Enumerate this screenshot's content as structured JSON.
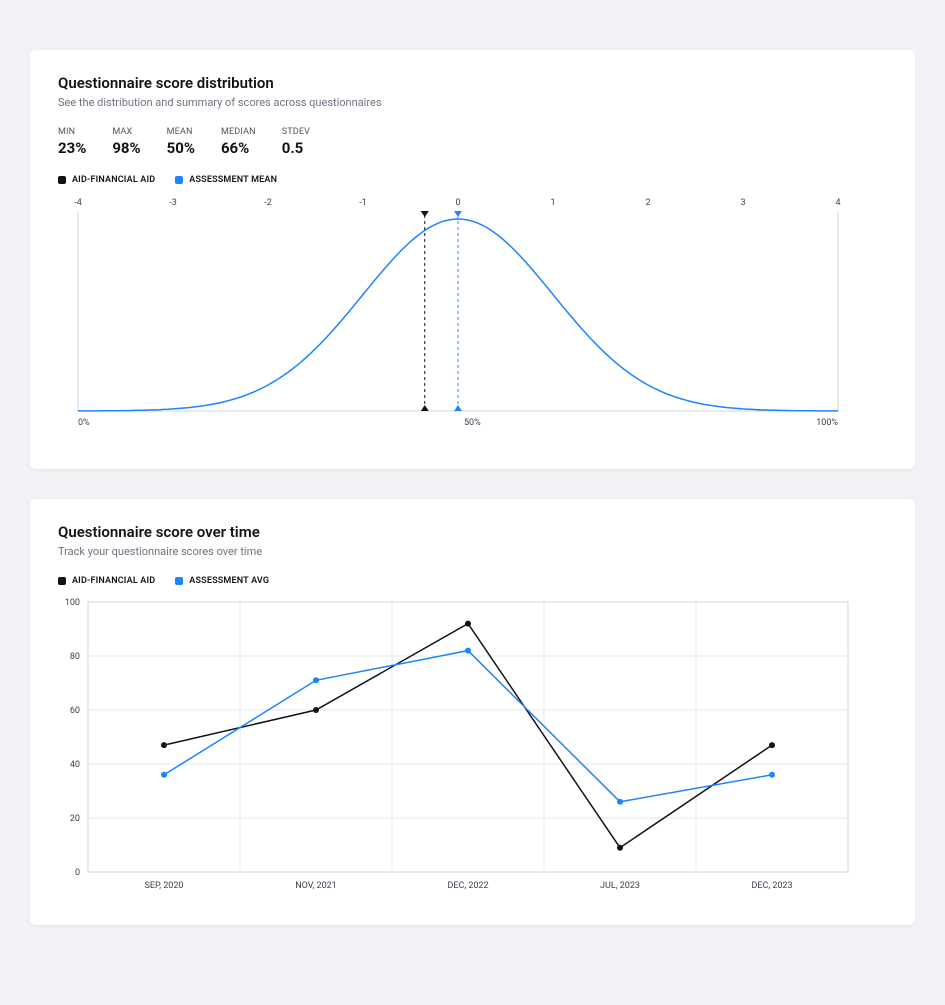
{
  "distribution": {
    "title": "Questionnaire score distribution",
    "subtitle": "See the distribution and summary of scores across questionnaires",
    "stats": {
      "min_label": "MIN",
      "min_value": "23%",
      "max_label": "MAX",
      "max_value": "98%",
      "mean_label": "MEAN",
      "mean_value": "50%",
      "median_label": "MEDIAN",
      "median_value": "66%",
      "stdev_label": "STDEV",
      "stdev_value": "0.5"
    },
    "legend": {
      "series1_label": "AID-FINANCIAL AID",
      "series1_color": "#0f1419",
      "series2_label": "ASSESSMENT MEAN",
      "series2_color": "#1b84ff"
    },
    "bottom_ticks": {
      "left": "0%",
      "mid": "50%",
      "right": "100%"
    }
  },
  "timeseries": {
    "title": "Questionnaire score over time",
    "subtitle": "Track your questionnaire scores over time",
    "legend": {
      "series1_label": "AID-FINANCIAL AID",
      "series1_color": "#0f1419",
      "series2_label": "ASSESSMENT AVG",
      "series2_color": "#1b84ff"
    }
  },
  "chart_data": [
    {
      "type": "line",
      "title": "Questionnaire score distribution",
      "xlabel": "",
      "ylabel": "",
      "x_ticks": [
        -4,
        -3,
        -2,
        -1,
        0,
        1,
        2,
        3,
        4
      ],
      "bottom_axis_ticks": [
        "0%",
        "50%",
        "100%"
      ],
      "distribution_curve_sigma": 1,
      "markers": [
        {
          "name": "AID-FINANCIAL AID",
          "x": -0.35,
          "color": "#0f1419"
        },
        {
          "name": "ASSESSMENT MEAN",
          "x": 0.0,
          "color": "#1b84ff"
        }
      ]
    },
    {
      "type": "line",
      "title": "Questionnaire score over time",
      "xlabel": "",
      "ylabel": "",
      "ylim": [
        0,
        100
      ],
      "y_ticks": [
        0,
        20,
        40,
        60,
        80,
        100
      ],
      "categories": [
        "SEP, 2020",
        "NOV, 2021",
        "DEC, 2022",
        "JUL, 2023",
        "DEC, 2023"
      ],
      "series": [
        {
          "name": "AID-FINANCIAL AID",
          "color": "#0f1419",
          "values": [
            47,
            60,
            92,
            9,
            47
          ]
        },
        {
          "name": "ASSESSMENT AVG",
          "color": "#1b84ff",
          "values": [
            36,
            71,
            82,
            26,
            36
          ]
        }
      ]
    }
  ]
}
